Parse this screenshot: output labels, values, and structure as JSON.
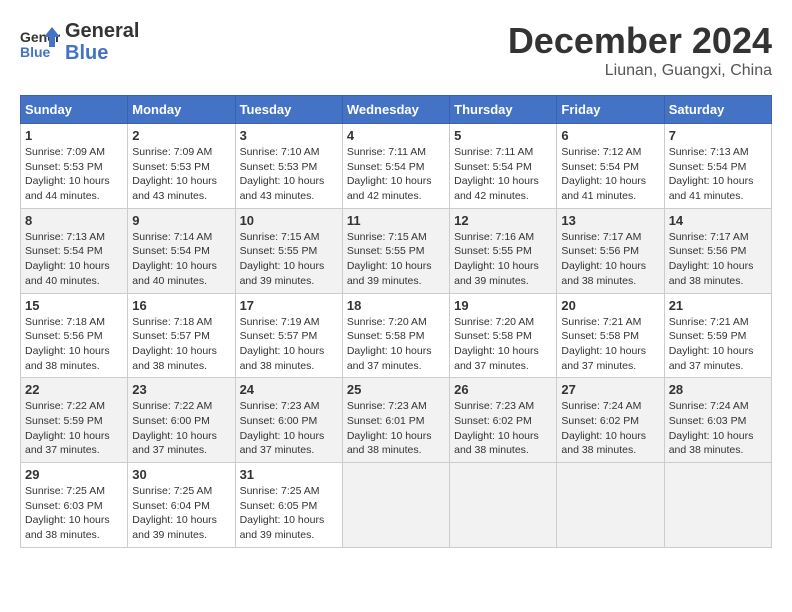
{
  "header": {
    "logo_line1": "General",
    "logo_line2": "Blue",
    "title": "December 2024",
    "subtitle": "Liunan, Guangxi, China"
  },
  "calendar": {
    "days_of_week": [
      "Sunday",
      "Monday",
      "Tuesday",
      "Wednesday",
      "Thursday",
      "Friday",
      "Saturday"
    ],
    "weeks": [
      [
        null,
        null,
        {
          "day": 3,
          "sunrise": "7:10 AM",
          "sunset": "5:53 PM",
          "daylight": "10 hours and 43 minutes."
        },
        {
          "day": 4,
          "sunrise": "7:11 AM",
          "sunset": "5:54 PM",
          "daylight": "10 hours and 42 minutes."
        },
        {
          "day": 5,
          "sunrise": "7:11 AM",
          "sunset": "5:54 PM",
          "daylight": "10 hours and 42 minutes."
        },
        {
          "day": 6,
          "sunrise": "7:12 AM",
          "sunset": "5:54 PM",
          "daylight": "10 hours and 41 minutes."
        },
        {
          "day": 7,
          "sunrise": "7:13 AM",
          "sunset": "5:54 PM",
          "daylight": "10 hours and 41 minutes."
        }
      ],
      [
        {
          "day": 1,
          "sunrise": "7:09 AM",
          "sunset": "5:53 PM",
          "daylight": "10 hours and 44 minutes."
        },
        {
          "day": 2,
          "sunrise": "7:09 AM",
          "sunset": "5:53 PM",
          "daylight": "10 hours and 43 minutes."
        },
        null,
        null,
        null,
        null,
        null
      ],
      [
        {
          "day": 8,
          "sunrise": "7:13 AM",
          "sunset": "5:54 PM",
          "daylight": "10 hours and 40 minutes."
        },
        {
          "day": 9,
          "sunrise": "7:14 AM",
          "sunset": "5:54 PM",
          "daylight": "10 hours and 40 minutes."
        },
        {
          "day": 10,
          "sunrise": "7:15 AM",
          "sunset": "5:55 PM",
          "daylight": "10 hours and 39 minutes."
        },
        {
          "day": 11,
          "sunrise": "7:15 AM",
          "sunset": "5:55 PM",
          "daylight": "10 hours and 39 minutes."
        },
        {
          "day": 12,
          "sunrise": "7:16 AM",
          "sunset": "5:55 PM",
          "daylight": "10 hours and 39 minutes."
        },
        {
          "day": 13,
          "sunrise": "7:17 AM",
          "sunset": "5:56 PM",
          "daylight": "10 hours and 38 minutes."
        },
        {
          "day": 14,
          "sunrise": "7:17 AM",
          "sunset": "5:56 PM",
          "daylight": "10 hours and 38 minutes."
        }
      ],
      [
        {
          "day": 15,
          "sunrise": "7:18 AM",
          "sunset": "5:56 PM",
          "daylight": "10 hours and 38 minutes."
        },
        {
          "day": 16,
          "sunrise": "7:18 AM",
          "sunset": "5:57 PM",
          "daylight": "10 hours and 38 minutes."
        },
        {
          "day": 17,
          "sunrise": "7:19 AM",
          "sunset": "5:57 PM",
          "daylight": "10 hours and 38 minutes."
        },
        {
          "day": 18,
          "sunrise": "7:20 AM",
          "sunset": "5:58 PM",
          "daylight": "10 hours and 37 minutes."
        },
        {
          "day": 19,
          "sunrise": "7:20 AM",
          "sunset": "5:58 PM",
          "daylight": "10 hours and 37 minutes."
        },
        {
          "day": 20,
          "sunrise": "7:21 AM",
          "sunset": "5:58 PM",
          "daylight": "10 hours and 37 minutes."
        },
        {
          "day": 21,
          "sunrise": "7:21 AM",
          "sunset": "5:59 PM",
          "daylight": "10 hours and 37 minutes."
        }
      ],
      [
        {
          "day": 22,
          "sunrise": "7:22 AM",
          "sunset": "5:59 PM",
          "daylight": "10 hours and 37 minutes."
        },
        {
          "day": 23,
          "sunrise": "7:22 AM",
          "sunset": "6:00 PM",
          "daylight": "10 hours and 37 minutes."
        },
        {
          "day": 24,
          "sunrise": "7:23 AM",
          "sunset": "6:00 PM",
          "daylight": "10 hours and 37 minutes."
        },
        {
          "day": 25,
          "sunrise": "7:23 AM",
          "sunset": "6:01 PM",
          "daylight": "10 hours and 38 minutes."
        },
        {
          "day": 26,
          "sunrise": "7:23 AM",
          "sunset": "6:02 PM",
          "daylight": "10 hours and 38 minutes."
        },
        {
          "day": 27,
          "sunrise": "7:24 AM",
          "sunset": "6:02 PM",
          "daylight": "10 hours and 38 minutes."
        },
        {
          "day": 28,
          "sunrise": "7:24 AM",
          "sunset": "6:03 PM",
          "daylight": "10 hours and 38 minutes."
        }
      ],
      [
        {
          "day": 29,
          "sunrise": "7:25 AM",
          "sunset": "6:03 PM",
          "daylight": "10 hours and 38 minutes."
        },
        {
          "day": 30,
          "sunrise": "7:25 AM",
          "sunset": "6:04 PM",
          "daylight": "10 hours and 39 minutes."
        },
        {
          "day": 31,
          "sunrise": "7:25 AM",
          "sunset": "6:05 PM",
          "daylight": "10 hours and 39 minutes."
        },
        null,
        null,
        null,
        null
      ]
    ]
  }
}
